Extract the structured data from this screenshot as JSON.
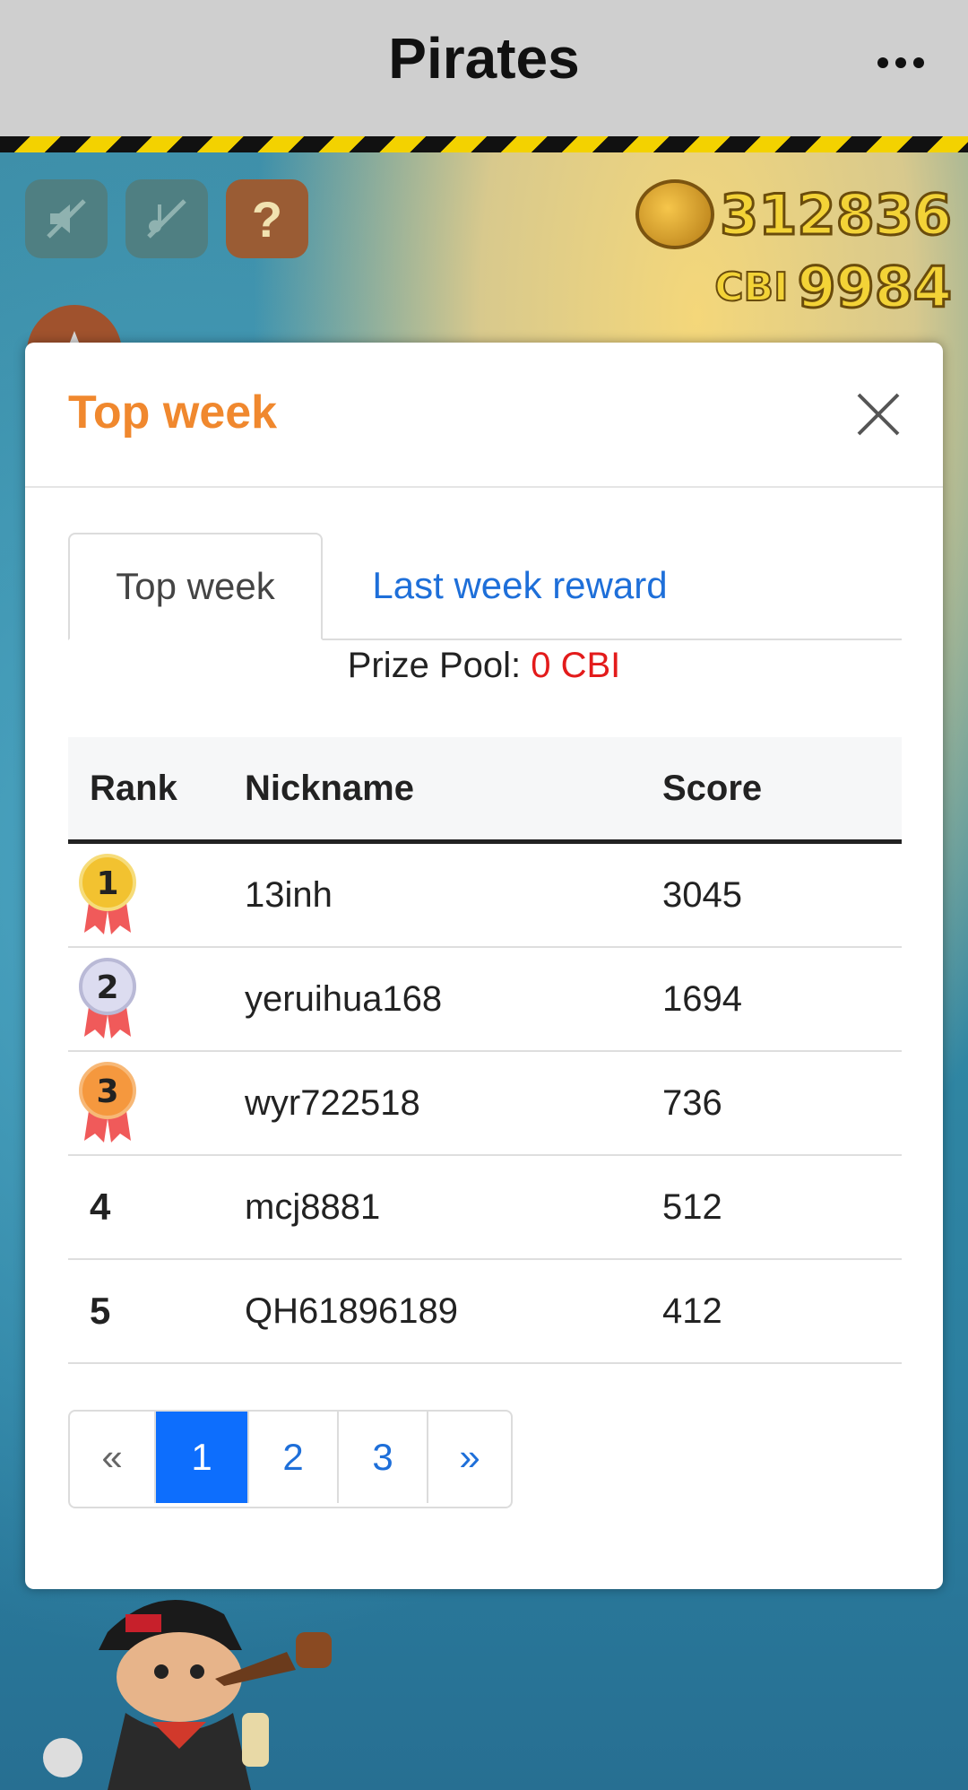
{
  "appbar": {
    "title": "Pirates"
  },
  "game": {
    "coins": "312836",
    "cbi_label": "CBI",
    "cbi_value": "9984",
    "help_label": "?"
  },
  "modal": {
    "title": "Top week",
    "tabs": [
      {
        "label": "Top week",
        "active": true
      },
      {
        "label": "Last week reward",
        "active": false
      }
    ],
    "prize_label": "Prize Pool:",
    "prize_amount": "0 CBI",
    "table": {
      "headers": [
        "Rank",
        "Nickname",
        "Score"
      ],
      "rows": [
        {
          "rank": "1",
          "nickname": "13inh",
          "score": "3045",
          "medal": "gold"
        },
        {
          "rank": "2",
          "nickname": "yeruihua168",
          "score": "1694",
          "medal": "silver"
        },
        {
          "rank": "3",
          "nickname": "wyr722518",
          "score": "736",
          "medal": "bronze"
        },
        {
          "rank": "4",
          "nickname": "mcj8881",
          "score": "512",
          "medal": ""
        },
        {
          "rank": "5",
          "nickname": "QH61896189",
          "score": "412",
          "medal": ""
        }
      ]
    },
    "pagination": {
      "prev": "«",
      "pages": [
        "1",
        "2",
        "3"
      ],
      "current": "1",
      "next": "»"
    }
  },
  "colors": {
    "accent": "#f0882e",
    "link": "#1e6fd9",
    "prize": "#e31b1b",
    "active_page": "#0d6efd"
  }
}
